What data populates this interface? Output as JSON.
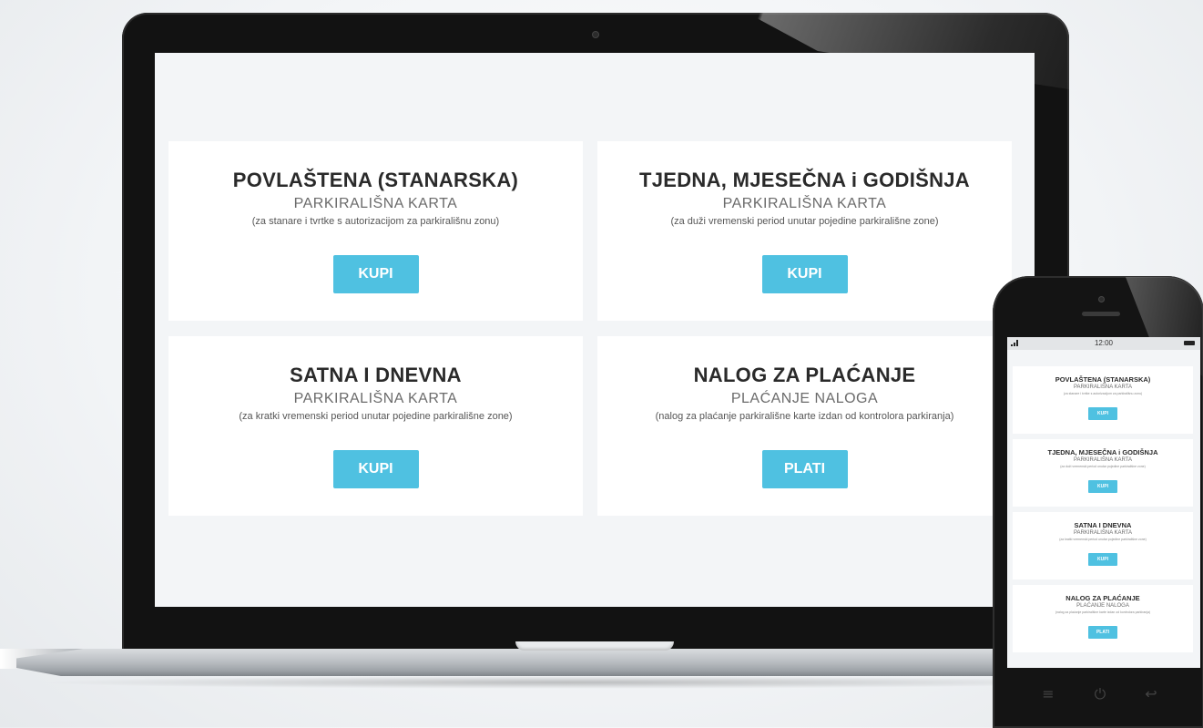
{
  "laptop_page": {
    "cards": [
      {
        "title": "POVLAŠTENA (STANARSKA)",
        "subtitle": "PARKIRALIŠNA KARTA",
        "description": "(za stanare i tvrtke s autorizacijom za parkirališnu zonu)",
        "button_label": "KUPI"
      },
      {
        "title": "TJEDNA, MJESEČNA i GODIŠNJA",
        "subtitle": "PARKIRALIŠNA KARTA",
        "description": "(za duži vremenski period unutar pojedine parkirališne zone)",
        "button_label": "KUPI"
      },
      {
        "title": "SATNA I DNEVNA",
        "subtitle": "PARKIRALIŠNA KARTA",
        "description": "(za kratki vremenski period unutar pojedine parkirališne zone)",
        "button_label": "KUPI"
      },
      {
        "title": "NALOG ZA PLAĆANJE",
        "subtitle": "PLAĆANJE NALOGA",
        "description": "(nalog za plaćanje parkirališne karte izdan od kontrolora parkiranja)",
        "button_label": "PLATI"
      }
    ]
  },
  "phone_page": {
    "status_time": "12:00",
    "cards": [
      {
        "title": "POVLAŠTENA (STANARSKA)",
        "subtitle": "PARKIRALIŠNA KARTA",
        "description": "(za stanare i tvrtke s autorizacijom za parkirališnu zonu)",
        "button_label": "KUPI"
      },
      {
        "title": "TJEDNA, MJESEČNA i GODIŠNJA",
        "subtitle": "PARKIRALIŠNA KARTA",
        "description": "(za duži vremenski period unutar pojedine parkirališne zone)",
        "button_label": "KUPI"
      },
      {
        "title": "SATNA I DNEVNA",
        "subtitle": "PARKIRALIŠNA KARTA",
        "description": "(za kratki vremenski period unutar pojedine parkirališne zone)",
        "button_label": "KUPI"
      },
      {
        "title": "NALOG ZA PLAĆANJE",
        "subtitle": "PLAĆANJE NALOGA",
        "description": "(nalog za plaćanje parkirališne karte izdan od kontrolora parkiranja)",
        "button_label": "PLATI"
      }
    ],
    "nav_icons": [
      "menu-icon",
      "power-icon",
      "back-icon"
    ]
  },
  "colors": {
    "accent": "#4fc1e1",
    "page_background": "#f3f5f7",
    "card_background": "#ffffff",
    "title_text": "#2a2a2a"
  }
}
